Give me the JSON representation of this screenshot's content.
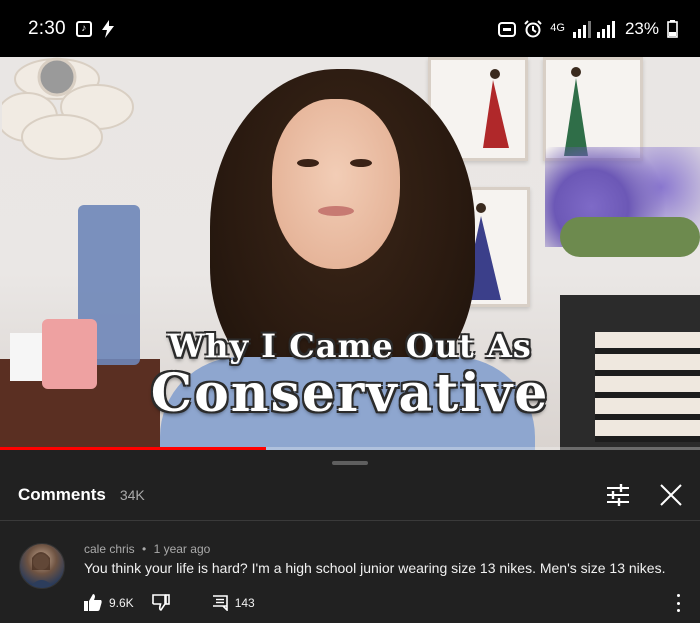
{
  "status_bar": {
    "time": "2:30",
    "network": "4G",
    "battery": "23%"
  },
  "video": {
    "title_line1": "Why I Came Out As",
    "title_line2": "Conservative",
    "progress_percent": 38
  },
  "comments_panel": {
    "title": "Comments",
    "count": "34K",
    "comment": {
      "author": "cale chris",
      "separator": "•",
      "time": "1 year ago",
      "text": "You think your life is hard? I'm a high school junior wearing size 13 nikes. Men's size 13 nikes.",
      "likes": "9.6K",
      "replies": "143"
    }
  },
  "colors": {
    "sheet_bg": "#212121",
    "progress": "#ff0000"
  }
}
